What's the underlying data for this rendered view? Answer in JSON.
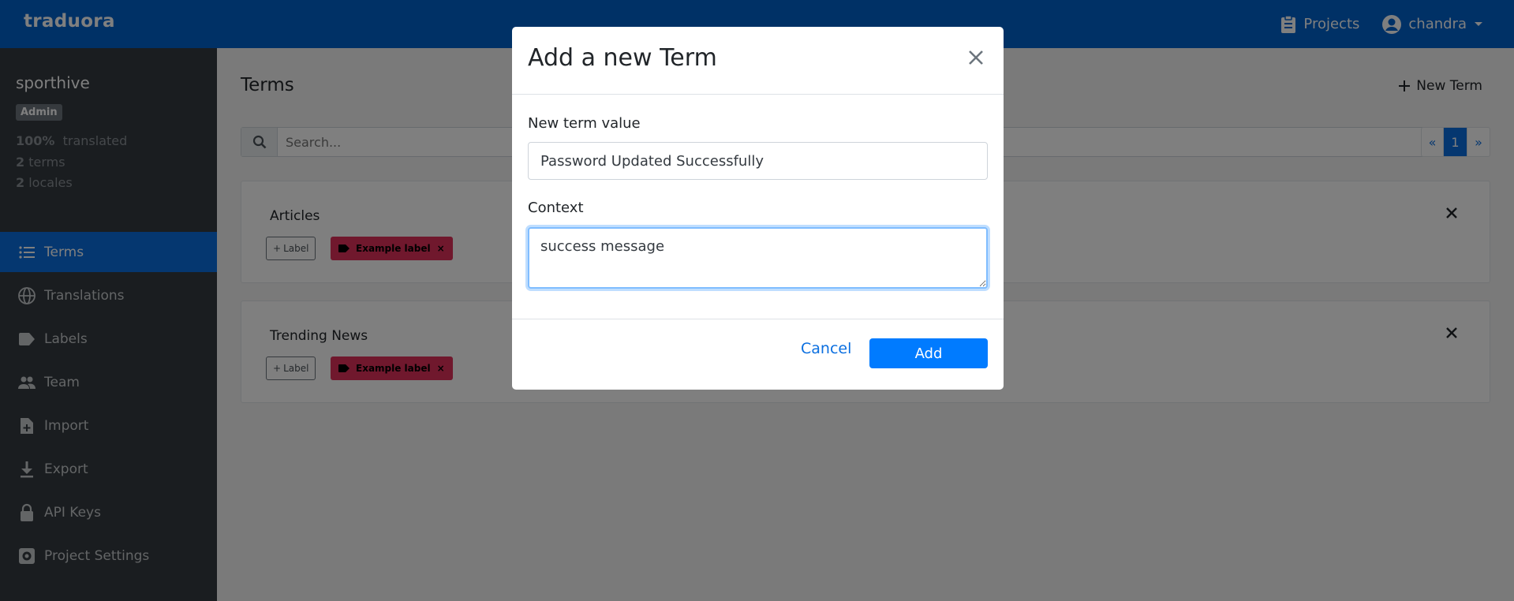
{
  "navbar": {
    "brand": "traduora",
    "projects_label": "Projects",
    "user_label": "chandra"
  },
  "sidebar": {
    "project_name": "sporthive",
    "role_badge": "Admin",
    "stats": {
      "translated_pct": "100%",
      "translated_label": "translated",
      "terms_count": "2",
      "terms_label": "terms",
      "locales_count": "2",
      "locales_label": "locales"
    },
    "items": [
      {
        "label": "Terms",
        "icon": "list-icon"
      },
      {
        "label": "Translations",
        "icon": "globe-icon"
      },
      {
        "label": "Labels",
        "icon": "tag-icon"
      },
      {
        "label": "Team",
        "icon": "people-icon"
      },
      {
        "label": "Import",
        "icon": "file-plus-icon"
      },
      {
        "label": "Export",
        "icon": "download-icon"
      },
      {
        "label": "API Keys",
        "icon": "lock-icon"
      },
      {
        "label": "Project Settings",
        "icon": "gear-icon"
      }
    ]
  },
  "main": {
    "title": "Terms",
    "new_term_label": "New Term",
    "search_placeholder": "Search...",
    "pagination": {
      "prev": "«",
      "current": "1",
      "next": "»"
    },
    "terms": [
      {
        "name": "Articles",
        "add_label": "Label",
        "label_tag": "Example label"
      },
      {
        "name": "Trending News",
        "add_label": "Label",
        "label_tag": "Example label"
      }
    ]
  },
  "modal": {
    "title": "Add a new Term",
    "term_value_label": "New term value",
    "term_value": "Password Updated Successfully",
    "context_label": "Context",
    "context_value": "success message",
    "cancel_label": "Cancel",
    "add_label": "Add"
  },
  "colors": {
    "primary": "#007bff",
    "navbar": "#0062cc",
    "sidebar": "#343a40",
    "label_tag": "#e0315a"
  }
}
